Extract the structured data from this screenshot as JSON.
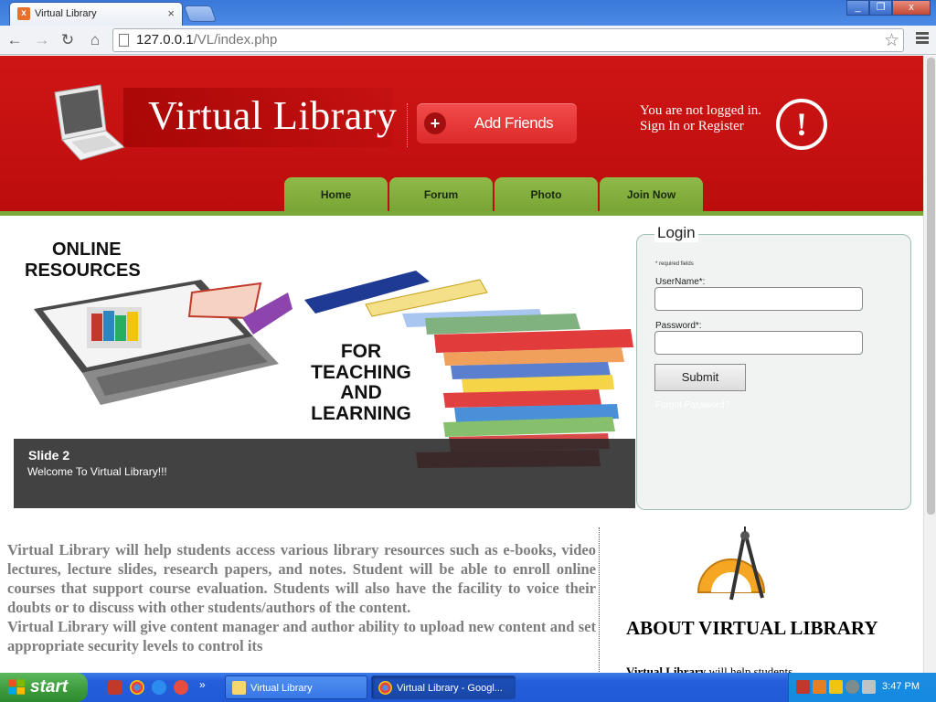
{
  "browser": {
    "tab_title": "Virtual Library",
    "tab_close": "×",
    "url_host": "127.0.0.1",
    "url_path": "/VL/index.php",
    "win_minimize": "_",
    "win_restore": "❐",
    "win_close": "x"
  },
  "toolbar": {
    "back": "←",
    "forward": "→",
    "reload": "↻",
    "home": "⌂",
    "star": "☆"
  },
  "header": {
    "site_title": "Virtual Library",
    "add_friends_label": "Add Friends",
    "add_friends_plus": "+",
    "login_status_line1": "You are not logged in.",
    "login_status_line2": "Sign In or Register",
    "alert_symbol": "!"
  },
  "nav": {
    "items": [
      {
        "label": "Home"
      },
      {
        "label": "Forum"
      },
      {
        "label": "Photo"
      },
      {
        "label": "Join Now"
      }
    ]
  },
  "slider": {
    "heading_line1": "ONLINE",
    "heading_line2": "RESOURCES",
    "tagline_line1": "FOR",
    "tagline_line2": "TEACHING",
    "tagline_line3": "AND",
    "tagline_line4": "LEARNING",
    "caption_title": "Slide 2",
    "caption_text": "Welcome To Virtual Library!!!"
  },
  "login": {
    "legend": "Login",
    "required_note": "* required fields",
    "username_label": "UserName*:",
    "username_value": "",
    "password_label": "Password*:",
    "password_value": "",
    "submit_label": "Submit",
    "forgot_label": "Forgot Password?"
  },
  "content": {
    "intro_p1": "Virtual Library will help students access various library resources such as e-books, video lectures, lecture slides, research papers, and notes. Student will be able to enroll online courses that support course evaluation. Students will also have the facility to voice their doubts or to discuss with other students/authors of the content.",
    "intro_p2": "Virtual Library will give content manager and author ability to upload new content and set appropriate security levels to control its",
    "about_title": "ABOUT VIRTUAL LIBRARY",
    "about_sub_bold": "Virtual Library",
    "about_sub_rest": " will help students"
  },
  "taskbar": {
    "start_label": "start",
    "more": "»",
    "task1_label": "Virtual Library",
    "task2_label": "Virtual Library - Googl...",
    "clock": "3:47 PM"
  }
}
